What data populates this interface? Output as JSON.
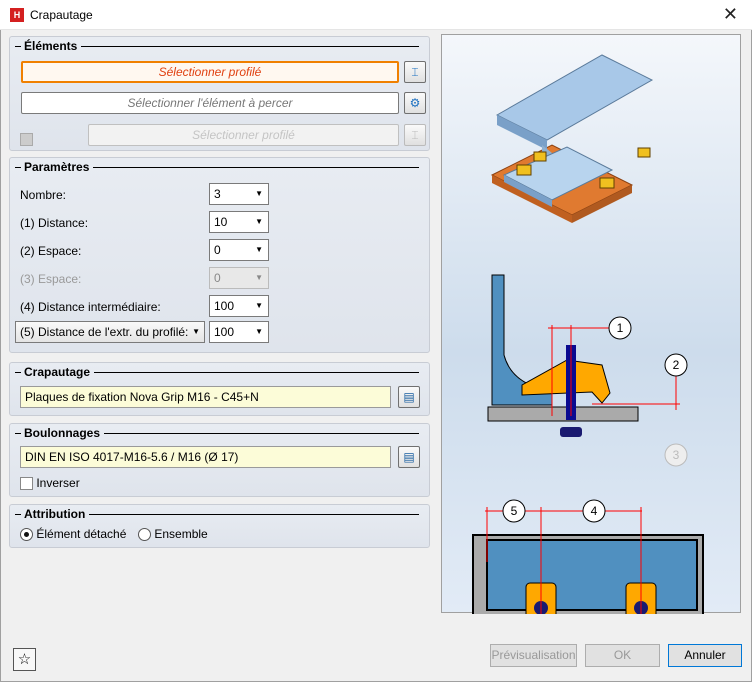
{
  "window": {
    "title": "Crapautage",
    "app_icon": "HiCAD",
    "close": "✕"
  },
  "elements": {
    "title": "Éléments",
    "select_profile": "Sélectionner profilé",
    "select_part": "Sélectionner l'élément à percer",
    "select_profile2": "Sélectionner profilé"
  },
  "params": {
    "title": "Paramètres",
    "rows": [
      {
        "label": "Nombre:",
        "value": "3"
      },
      {
        "label": "(1) Distance:",
        "value": "10"
      },
      {
        "label": "(2) Espace:",
        "value": "0"
      },
      {
        "label": "(3) Espace:",
        "value": "0"
      },
      {
        "label": "(4) Distance intermédiaire:",
        "value": "100"
      },
      {
        "label": "(5) Distance de l'extr. du profilé:",
        "value": "100"
      }
    ]
  },
  "crapautage": {
    "title": "Crapautage",
    "value": "Plaques de fixation  Nova Grip M16 - C45+N"
  },
  "boulonnages": {
    "title": "Boulonnages",
    "value": "DIN EN ISO 4017-M16-5.6 / M16 (Ø 17)",
    "invert": "Inverser"
  },
  "attribution": {
    "title": "Attribution",
    "opt1": "Élément détaché",
    "opt2": "Ensemble"
  },
  "preview": {
    "callouts": [
      "1",
      "2",
      "3",
      "4",
      "5"
    ]
  },
  "footer": {
    "favorite": "☆",
    "preview": "Prévisualisation",
    "ok": "OK",
    "cancel": "Annuler"
  }
}
